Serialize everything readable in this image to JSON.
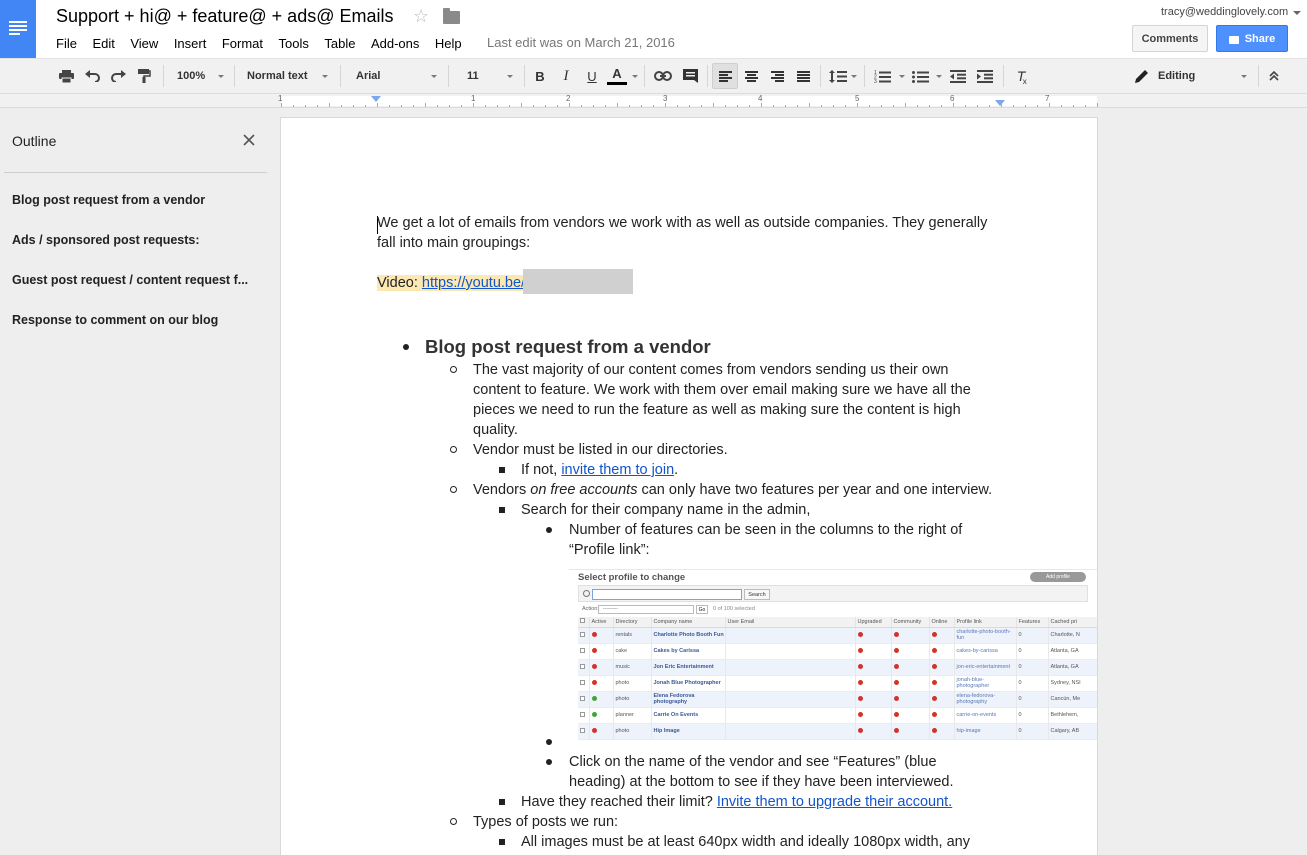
{
  "header": {
    "doc_title": "Support + hi@ + feature@ + ads@ Emails",
    "last_edit": "Last edit was on March 21, 2016",
    "account_email": "tracy@weddinglovely.com",
    "comments_label": "Comments",
    "share_label": "Share",
    "menu": [
      "File",
      "Edit",
      "View",
      "Insert",
      "Format",
      "Tools",
      "Table",
      "Add-ons",
      "Help"
    ]
  },
  "toolbar": {
    "zoom": "100%",
    "style": "Normal text",
    "font": "Arial",
    "font_size": "11",
    "mode": "Editing"
  },
  "ruler": {
    "numbers": [
      "1",
      "1",
      "2",
      "3",
      "4",
      "5",
      "6",
      "7"
    ]
  },
  "outline": {
    "title": "Outline",
    "items": [
      "Blog post request from a vendor",
      "Ads / sponsored post requests:",
      "Guest post request / content request f...",
      "Response to comment on our blog"
    ]
  },
  "document": {
    "intro_line1": "We get a lot of emails from vendors we work with as well as outside companies. They generally",
    "intro_line2": "fall into main groupings:",
    "video_label": "Video: ",
    "video_link": "https://youtu.be/",
    "heading1": "Blog post request from a vendor",
    "p1_line1": "The vast majority of our content comes from vendors sending us their own",
    "p1_line2": "content to feature. We work with them over email making sure we have all the",
    "p1_line3": "pieces we need to run the feature as well as making sure the content is high",
    "p1_line4": "quality.",
    "p2": "Vendor must be listed in our directories.",
    "p2a_pre": "If not, ",
    "p2a_link": "invite them to join",
    "p2a_post": ".",
    "p3_pre": "Vendors ",
    "p3_em": "on free accounts",
    "p3_post": " can only have two features per year and one interview.",
    "p3a": "Search for their company name in the admin,",
    "p3a1_line1": "Number of features can be seen in the columns to the right of",
    "p3a1_line2": "“Profile link”:",
    "p3a3_line1": "Click on the name of the vendor and see “Features” (blue",
    "p3a3_line2": "heading) at the bottom to see if they have been interviewed.",
    "p3b_pre": "Have they reached their limit? ",
    "p3b_link": "Invite them to upgrade their account.",
    "p4": "Types of posts we run:",
    "p4a": "All images must be at least 640px width and ideally 1080px width, any"
  },
  "admin_screenshot": {
    "title": "Select profile to change",
    "add_button": "Add profile",
    "search_button": "Search",
    "action_label": "Action:",
    "action_value": "---------",
    "go_button": "Go",
    "selected_count": "0 of 100 selected",
    "columns": [
      "Active",
      "Directory",
      "Company name",
      "User Email",
      "Upgraded",
      "Community",
      "Online",
      "Profile link",
      "Features",
      "Cached pri"
    ],
    "rows": [
      {
        "active": "red",
        "directory": "rentals",
        "company": "Charlotte Photo Booth Fun",
        "profile_link": "charlotte-photo-booth-fun",
        "features": "0",
        "city": "Charlotte, N"
      },
      {
        "active": "red",
        "directory": "cake",
        "company": "Cakes by Carissa",
        "profile_link": "cakes-by-carissa",
        "features": "0",
        "city": "Atlanta, GA"
      },
      {
        "active": "red",
        "directory": "music",
        "company": "Jon Eric Entertainment",
        "profile_link": "jon-eric-entertainment",
        "features": "0",
        "city": "Atlanta, GA"
      },
      {
        "active": "red",
        "directory": "photo",
        "company": "Jonah Blue Photographer",
        "profile_link": "jonah-blue-photographer",
        "features": "0",
        "city": "Sydney, NSI"
      },
      {
        "active": "green",
        "directory": "photo",
        "company": "Elena Fedorova photography",
        "profile_link": "elena-fedorova-photography",
        "features": "0",
        "city": "Cancún, Me"
      },
      {
        "active": "green",
        "directory": "planner",
        "company": "Carrie On Events",
        "profile_link": "carrie-on-events",
        "features": "0",
        "city": "Bethlehem,"
      },
      {
        "active": "red",
        "directory": "photo",
        "company": "Hip Image",
        "profile_link": "hip-image",
        "features": "0",
        "city": "Calgary, AB"
      }
    ]
  },
  "colors": {
    "docs_blue": "#4285f4",
    "share_blue": "#4d90fe",
    "link_blue": "#1155cc",
    "highlight": "#fce8b2",
    "status_red": "#d0342c",
    "status_green": "#3fa535"
  }
}
